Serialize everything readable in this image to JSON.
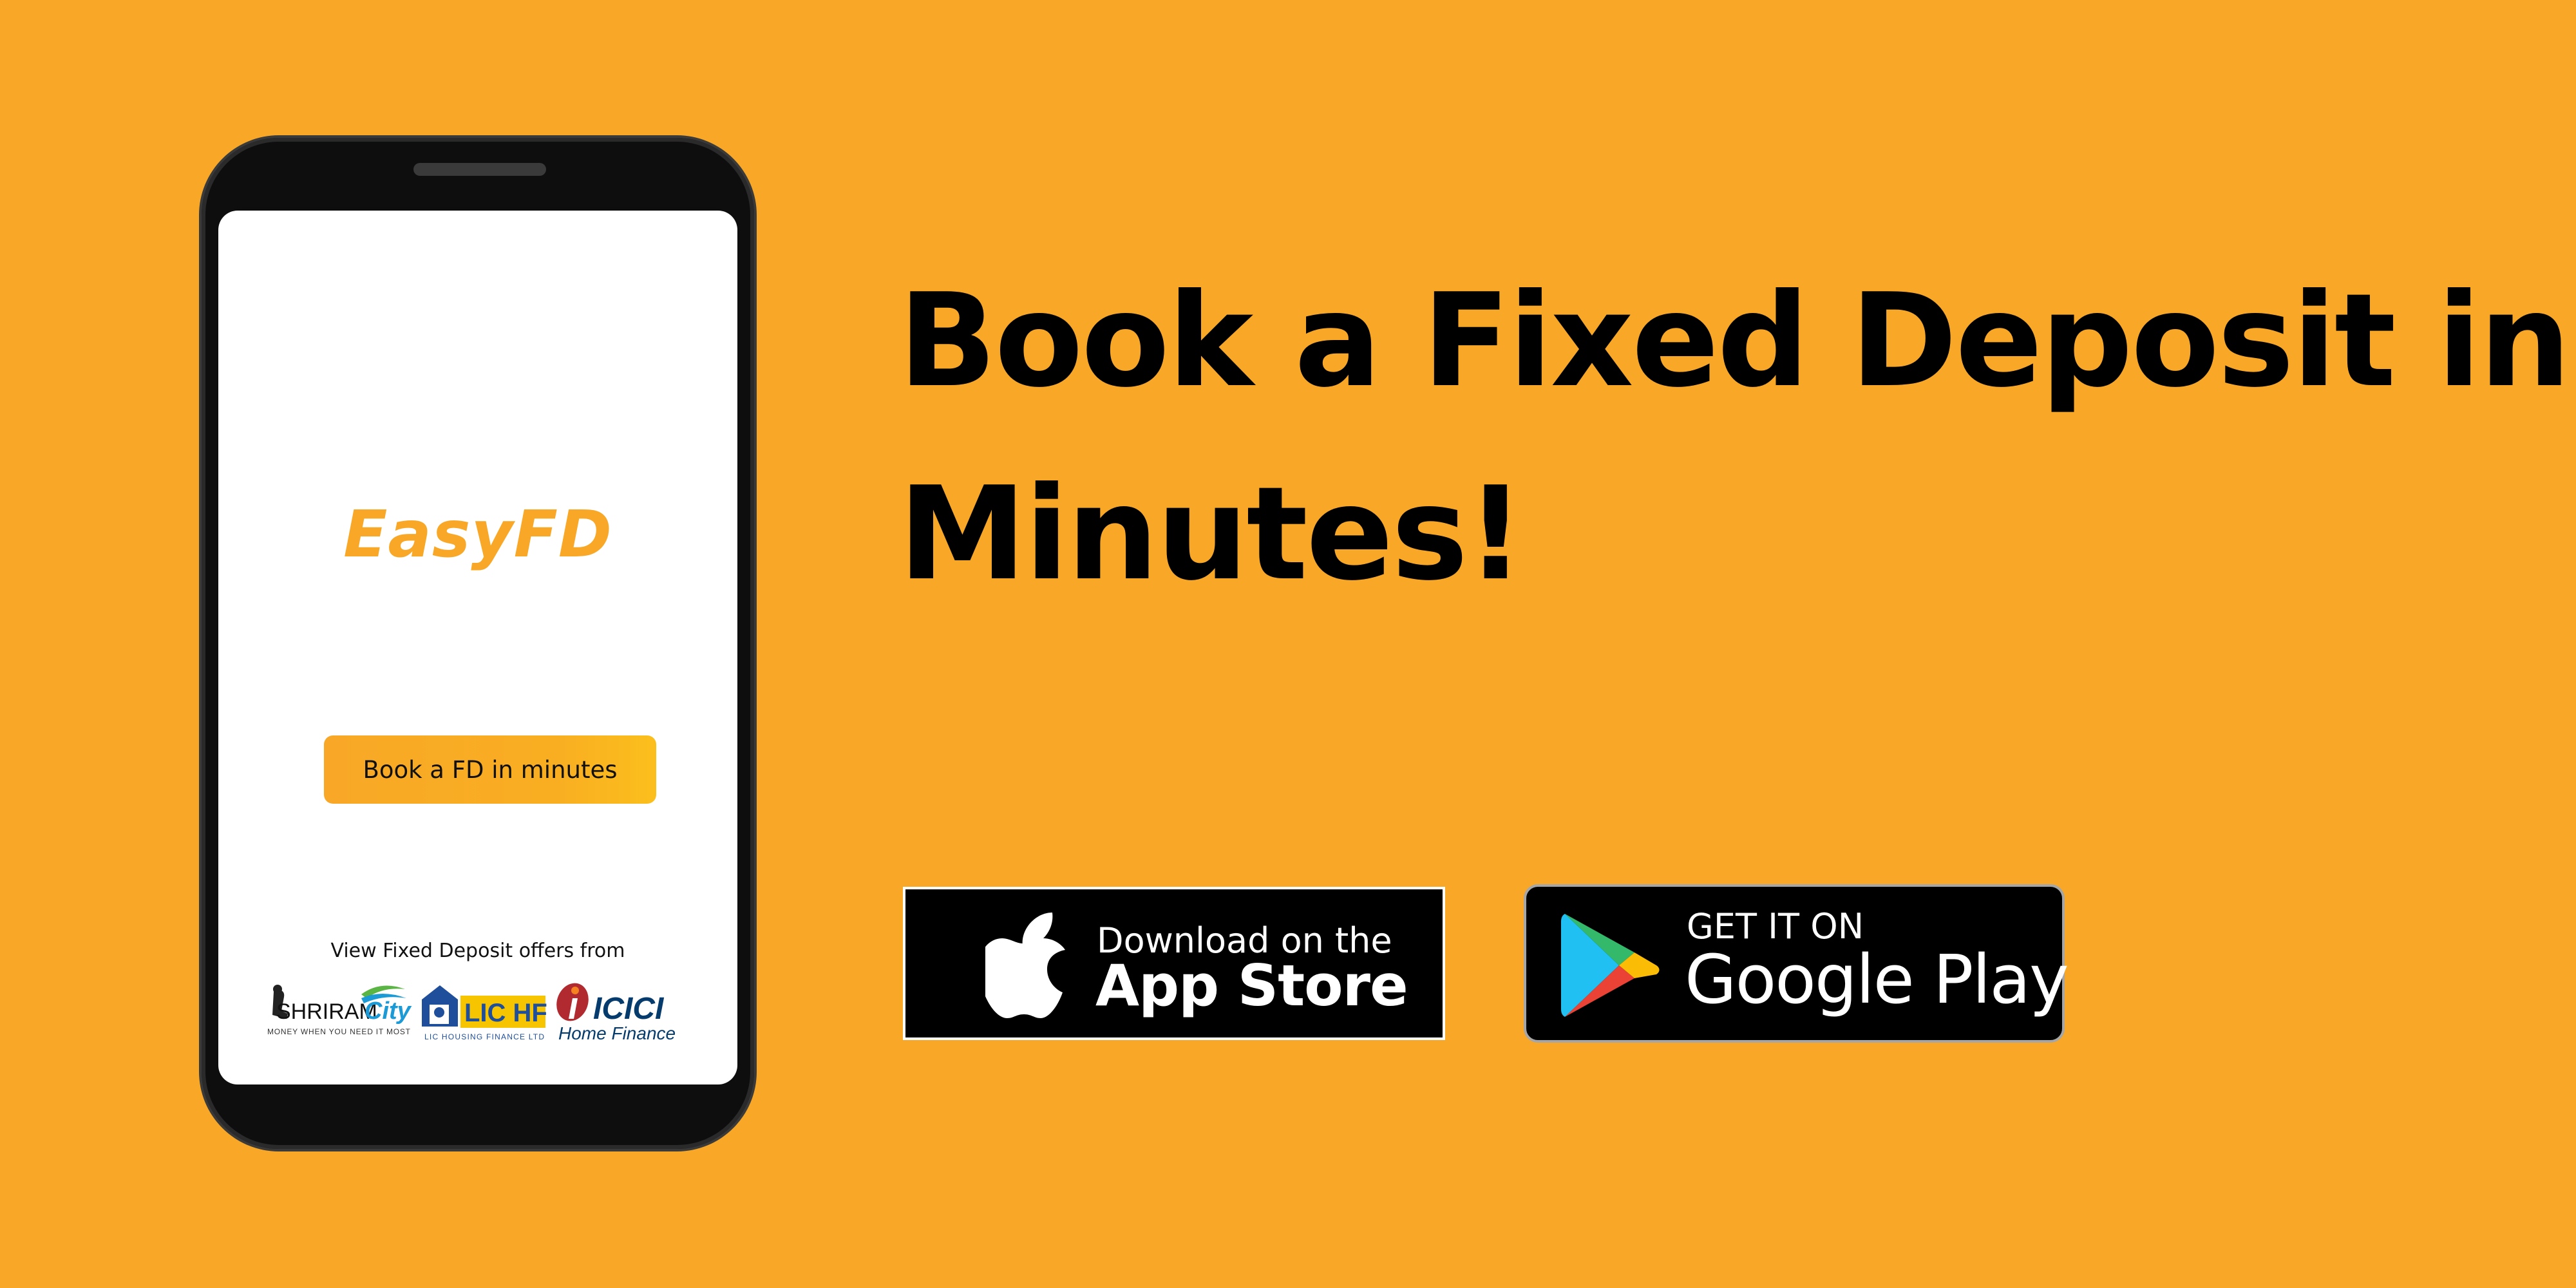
{
  "headline": {
    "line1": "Book a Fixed Deposit in",
    "line2": "Minutes!"
  },
  "phone": {
    "app_name": "EasyFD",
    "cta_label": "Book a FD in minutes",
    "offers_text": "View Fixed Deposit offers from",
    "lenders": {
      "shriram": {
        "name_a": "SHRIRAM",
        "name_b": "City",
        "tagline": "MONEY WHEN YOU NEED IT MOST"
      },
      "lic": {
        "name": "LIC HFL",
        "tagline": "LIC HOUSING FINANCE LTD"
      },
      "icici": {
        "name": "ICICI",
        "sub": "Home Finance"
      }
    }
  },
  "badges": {
    "appstore": {
      "small": "Download on the",
      "big": "App Store",
      "icon": "apple-icon"
    },
    "googleplay": {
      "small": "GET IT ON",
      "big": "Google Play",
      "icon": "google-play-icon"
    }
  },
  "colors": {
    "background": "#F8A826",
    "accent": "#F8A826",
    "text": "#000000"
  }
}
